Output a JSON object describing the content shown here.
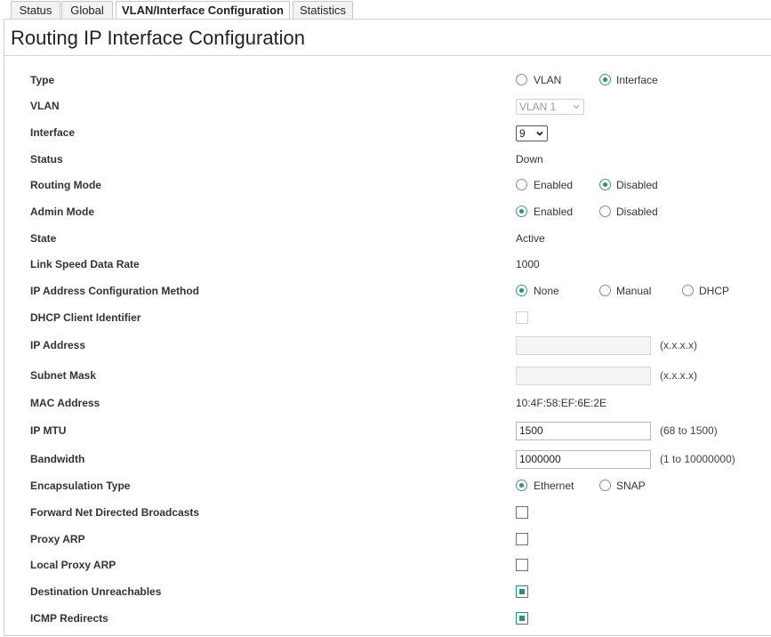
{
  "tabs": [
    "Status",
    "Global",
    "VLAN/Interface Configuration",
    "Statistics"
  ],
  "page_title": "Routing IP Interface Configuration",
  "fields": {
    "type": {
      "label": "Type",
      "options": [
        "VLAN",
        "Interface"
      ],
      "selected": "Interface"
    },
    "vlan": {
      "label": "VLAN",
      "value": "VLAN 1"
    },
    "interface": {
      "label": "Interface",
      "value": "9"
    },
    "status": {
      "label": "Status",
      "value": "Down"
    },
    "routing_mode": {
      "label": "Routing Mode",
      "options": [
        "Enabled",
        "Disabled"
      ],
      "selected": "Disabled"
    },
    "admin_mode": {
      "label": "Admin Mode",
      "options": [
        "Enabled",
        "Disabled"
      ],
      "selected": "Enabled"
    },
    "state": {
      "label": "State",
      "value": "Active"
    },
    "link_speed": {
      "label": "Link Speed Data Rate",
      "value": "1000"
    },
    "ip_method": {
      "label": "IP Address Configuration Method",
      "options": [
        "None",
        "Manual",
        "DHCP"
      ],
      "selected": "None"
    },
    "dhcp_client_id": {
      "label": "DHCP Client Identifier"
    },
    "ip_address": {
      "label": "IP Address",
      "value": "",
      "hint": "(x.x.x.x)"
    },
    "subnet_mask": {
      "label": "Subnet Mask",
      "value": "",
      "hint": "(x.x.x.x)"
    },
    "mac_address": {
      "label": "MAC Address",
      "value": "10:4F:58:EF:6E:2E"
    },
    "ip_mtu": {
      "label": "IP MTU",
      "value": "1500",
      "hint": "(68 to 1500)"
    },
    "bandwidth": {
      "label": "Bandwidth",
      "value": "1000000",
      "hint": "(1 to 10000000)"
    },
    "encapsulation": {
      "label": "Encapsulation Type",
      "options": [
        "Ethernet",
        "SNAP"
      ],
      "selected": "Ethernet"
    },
    "fwd_net_directed": {
      "label": "Forward Net Directed Broadcasts",
      "checked": false
    },
    "proxy_arp": {
      "label": "Proxy ARP",
      "checked": false
    },
    "local_proxy_arp": {
      "label": "Local Proxy ARP",
      "checked": false
    },
    "dest_unreachables": {
      "label": "Destination Unreachables",
      "checked": true
    },
    "icmp_redirects": {
      "label": "ICMP Redirects",
      "checked": true
    }
  },
  "colors": {
    "accent": "#2f8f7f"
  },
  "icons": {
    "select_arrow": "chevron-down-icon"
  }
}
